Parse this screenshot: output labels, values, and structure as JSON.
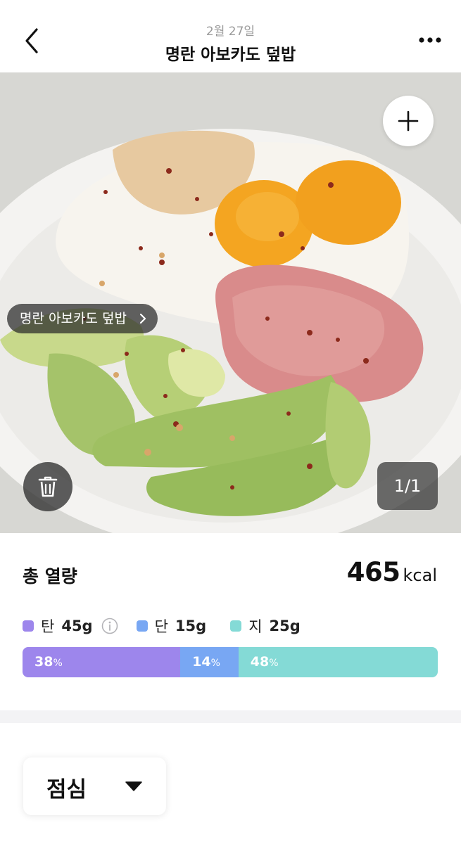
{
  "header": {
    "date": "2월 27일",
    "title": "명란 아보카도 덮밥"
  },
  "photo": {
    "tag_label": "명란 아보카도 덮밥",
    "counter": "1/1"
  },
  "calories": {
    "label": "총 열량",
    "value": "465",
    "unit": "kcal"
  },
  "macros": [
    {
      "name": "탄",
      "value": "45g",
      "color": "#9d86ec"
    },
    {
      "name": "단",
      "value": "15g",
      "color": "#78a7f3"
    },
    {
      "name": "지",
      "value": "25g",
      "color": "#84dad6"
    }
  ],
  "ratio_bar": [
    {
      "percent": "38",
      "fraction": 0.38,
      "color": "#9d86ec"
    },
    {
      "percent": "14",
      "fraction": 0.14,
      "color": "#78a7f3"
    },
    {
      "percent": "48",
      "fraction": 0.48,
      "color": "#84dad6"
    }
  ],
  "percent_symbol": "%",
  "meal": {
    "selected": "점심"
  },
  "icons": [
    "back-arrow-icon",
    "more-dots-icon",
    "plus-icon",
    "chevron-right-icon",
    "trash-icon",
    "info-icon",
    "caret-down-icon"
  ]
}
